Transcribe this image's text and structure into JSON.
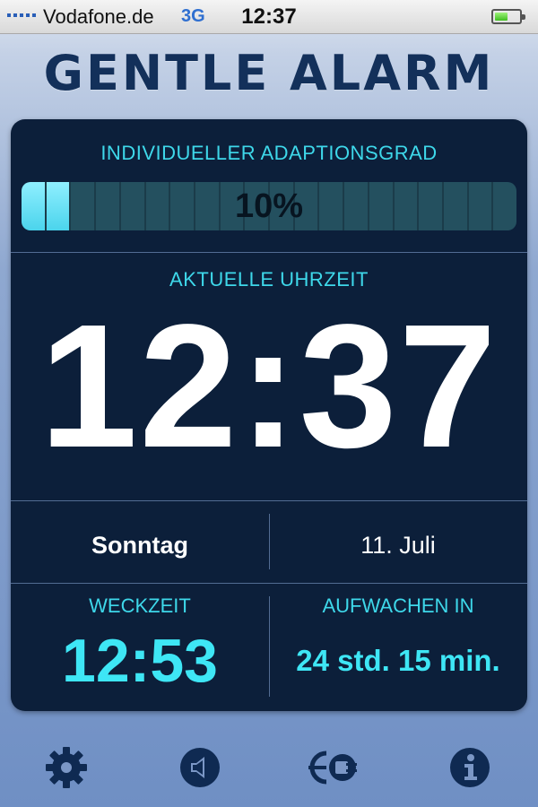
{
  "status_bar": {
    "carrier": "Vodafone.de",
    "network": "3G",
    "time": "12:37",
    "battery_fill_fraction": 0.55,
    "battery_color": "#3fbf1f"
  },
  "app": {
    "title": "GENTLE ALARM"
  },
  "adaption": {
    "label": "INDIVIDUELLER ADAPTIONSGRAD",
    "value_text": "10%",
    "value_fraction": 0.1,
    "segments_total": 20,
    "segments_on": 2
  },
  "clock": {
    "label": "AKTUELLE UHRZEIT",
    "time": "12:37"
  },
  "date": {
    "weekday": "Sonntag",
    "day_month": "11. Juli"
  },
  "alarm": {
    "wake_label": "WECKZEIT",
    "wake_time": "12:53",
    "countdown_label": "AUFWACHEN IN",
    "countdown": "24 std. 15 min."
  },
  "toolbar": {
    "icons": [
      "gear-icon",
      "speaker-icon",
      "plug-icon",
      "info-icon"
    ]
  },
  "colors": {
    "panel": "#0c1f3a",
    "accent_cyan": "#3ed8ea",
    "title": "#13305a"
  }
}
